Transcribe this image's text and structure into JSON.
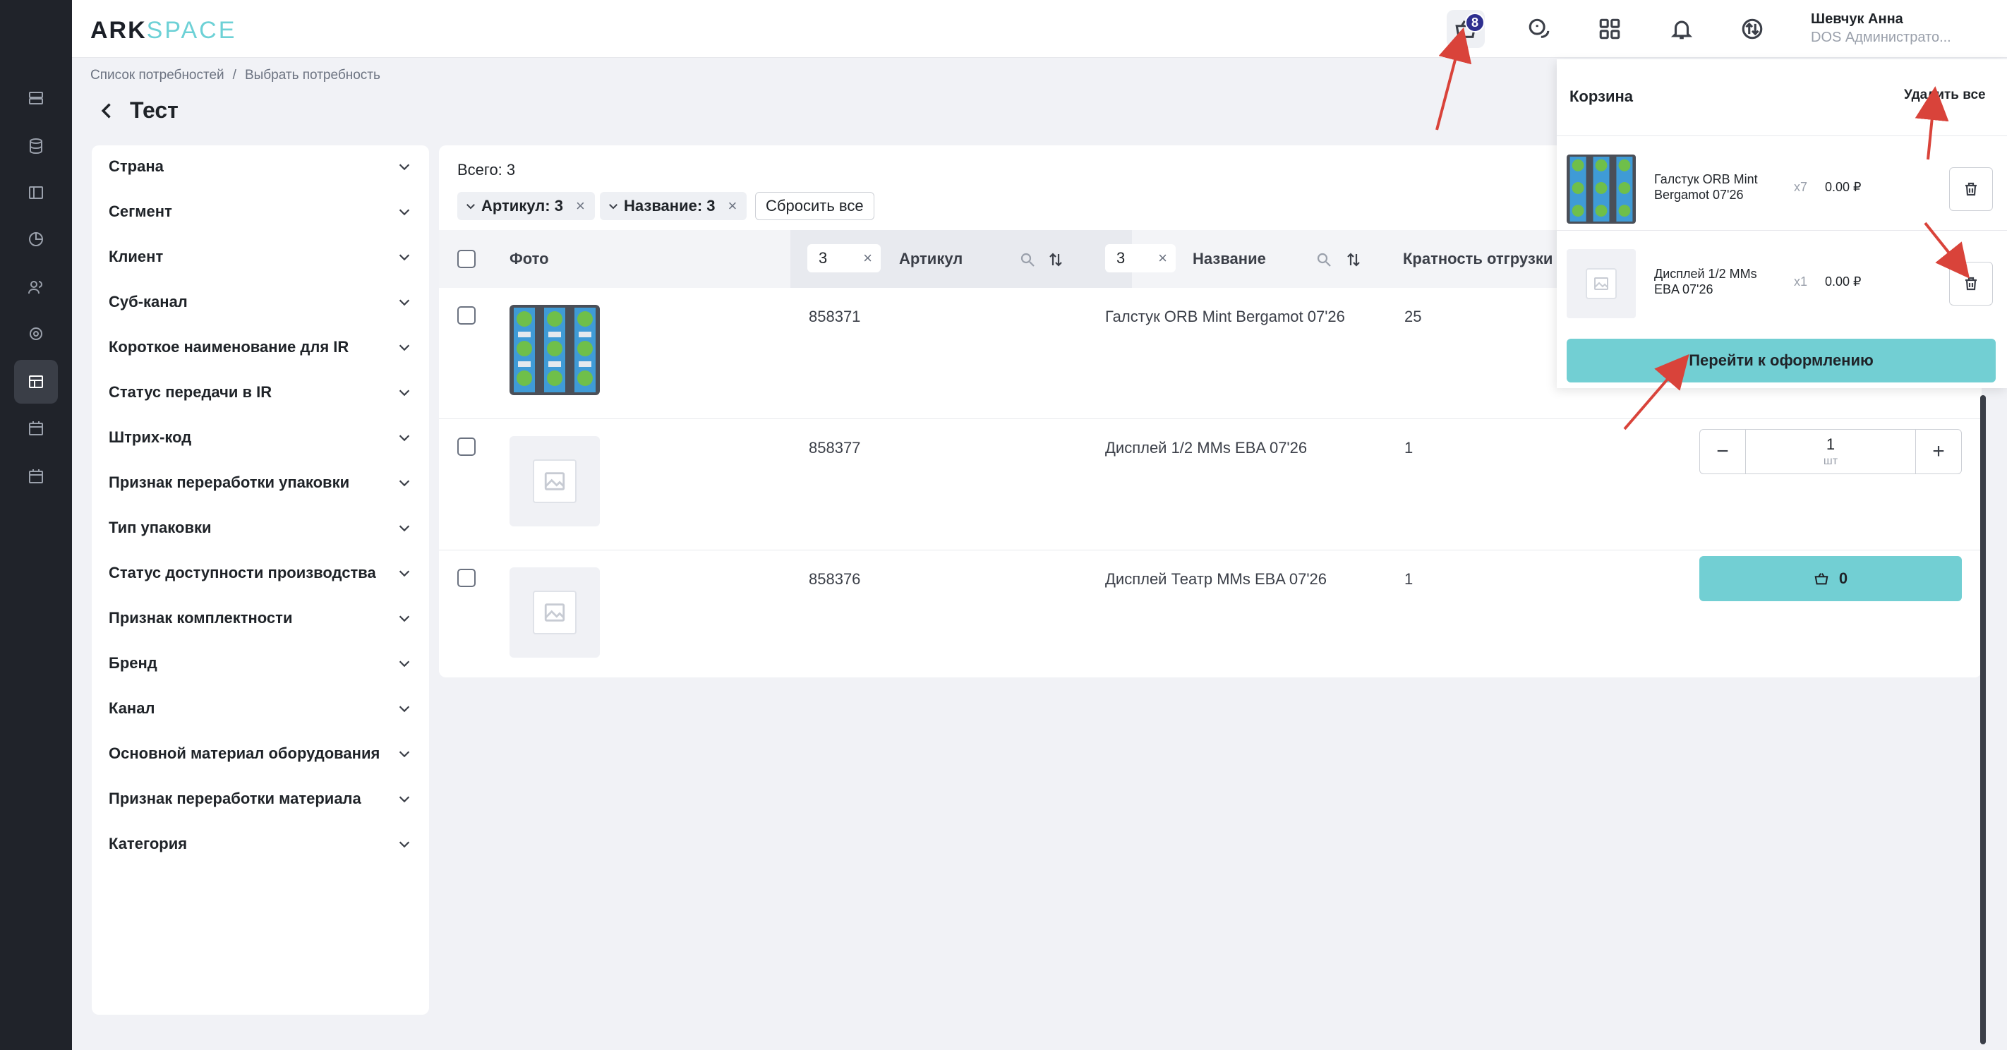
{
  "header": {
    "logo_main": "ARK",
    "logo_accent": "SPACE",
    "cart_badge": "8",
    "user_name": "Шевчук Анна",
    "user_role": "DOS Администрато..."
  },
  "breadcrumb": {
    "items": [
      "Список потребностей",
      "Выбрать потребность"
    ],
    "separator": "/"
  },
  "page_title": "Тест",
  "filters": [
    "Страна",
    "Сегмент",
    "Клиент",
    "Суб-канал",
    "Короткое наименование для IR",
    "Статус передачи в IR",
    "Штрих-код",
    "Признак переработки упаковки",
    "Тип упаковки",
    "Статус доступности производства",
    "Признак комплектности",
    "Бренд",
    "Канал",
    "Основной материал оборудования",
    "Признак переработки материала",
    "Категория"
  ],
  "table": {
    "total_label": "Всего: 3",
    "chips": [
      {
        "label": "Артикул: 3",
        "remove": "×"
      },
      {
        "label": "Название: 3",
        "remove": "×"
      }
    ],
    "reset_label": "Сбросить все",
    "columns": {
      "photo": "Фото",
      "article_filter": "3",
      "article": "Артикул",
      "name_filter": "3",
      "name": "Название",
      "multiplicity": "Кратность отгрузки"
    },
    "rows": [
      {
        "article": "858371",
        "name": "Галстук ORB Mint Bergamot 07'26",
        "multiplicity": "25",
        "image": "product-photo"
      },
      {
        "article": "858377",
        "name": "Дисплей 1/2 MMs EBA 07'26",
        "multiplicity": "1",
        "image": "placeholder",
        "qty": "1",
        "unit": "шт"
      },
      {
        "article": "858376",
        "name": "Дисплей Театр MMs EBA 07'26",
        "multiplicity": "1",
        "image": "placeholder",
        "add_count": "0"
      }
    ]
  },
  "cart": {
    "title": "Корзина",
    "clear_all": "Удалить все",
    "items": [
      {
        "name": "Галстук ORB Mint Bergamot 07'26",
        "qty": "x7",
        "price": "0.00 ₽"
      },
      {
        "name": "Дисплей 1/2 MMs EBA 07'26",
        "qty": "x1",
        "price": "0.00 ₽"
      }
    ],
    "checkout_label": "Перейти к оформлению"
  },
  "colors": {
    "accent": "#72cfd3",
    "sidebar": "#20232a",
    "badge": "#2e2f8f",
    "annotation_arrow": "#d9433a"
  }
}
